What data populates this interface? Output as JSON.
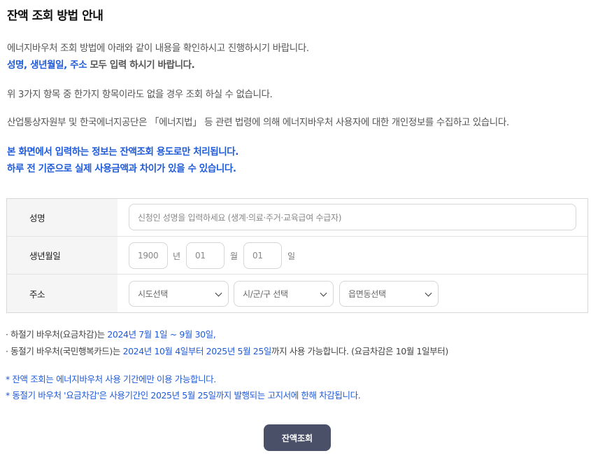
{
  "page": {
    "title": "잔액 조회 방법 안내"
  },
  "intro": {
    "line1": "에너지바우처 조회 방법에 아래와 같이 내용을 확인하시고 진행하시기 바랍니다.",
    "line2_highlight": "성명, 생년월일, 주소",
    "line2_rest": " 모두 입력 하시기 바랍니다.",
    "line3": "위 3가지 항목 중 한가지 항목이라도 없을 경우 조회 하실 수 없습니다.",
    "line4": "산업통상자원부 및 한국에너지공단은 「에너지법」 등 관련 법령에 의해 에너지바우처 사용자에 대한 개인정보를 수집하고 있습니다.",
    "line5": "본 화면에서 입력하는 정보는 잔액조회 용도로만 처리됩니다.",
    "line6": "하루 전 기준으로 실제 사용금액과 차이가 있을 수 있습니다."
  },
  "form": {
    "name": {
      "label": "성명",
      "placeholder": "신청인 성명을 입력하세요 (생계·의료·주거·교육급여 수급자)"
    },
    "birth": {
      "label": "생년월일",
      "year_placeholder": "1900",
      "year_unit": "년",
      "month_placeholder": "01",
      "month_unit": "월",
      "day_placeholder": "01",
      "day_unit": "일"
    },
    "address": {
      "label": "주소",
      "sido": "시도선택",
      "sigungu": "시/군/구 선택",
      "eupmyeondong": "읍면동선택"
    }
  },
  "notes": {
    "summer_prefix": "· 하절기 바우처(요금차감)는 ",
    "summer_period": "2024년 7월 1일 ~ 9월 30일",
    "summer_suffix": ",",
    "winter_prefix": "· 동절기 바우처(국민행복카드)는 ",
    "winter_period": "2024년 10월 4일부터 2025년 5월 25일",
    "winter_suffix": "까지 사용 가능합니다. (요금차감은 10월 1일부터)",
    "star1": "* 잔액 조회는 에너지바우처 사용 기간에만 이용 가능합니다.",
    "star2": "* 동절기 바우처 '요금차감'은 사용기간인 2025년 5월 25일까지 발행되는 고지서에 한해 차감됩니다."
  },
  "actions": {
    "submit_label": "잔액조회"
  },
  "colors": {
    "accent_blue": "#1f5bd8",
    "button_bg": "#4b5069"
  }
}
